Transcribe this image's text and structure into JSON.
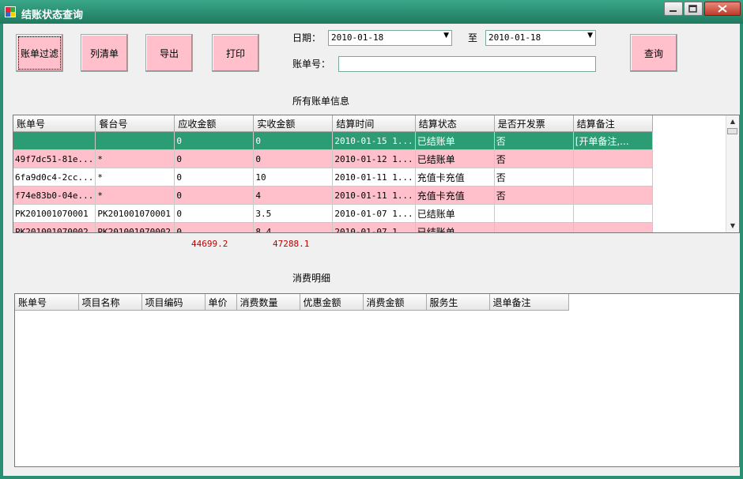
{
  "window": {
    "title": "结账状态查询"
  },
  "toolbar": {
    "filter_label": "账单过滤",
    "list_label": "列清单",
    "export_label": "导出",
    "print_label": "打印",
    "query_label": "查询"
  },
  "filters": {
    "date_label": "日期：",
    "to_label": "至",
    "date_from": "2010-01-18",
    "date_to": "2010-01-18",
    "bill_no_label": "账单号：",
    "bill_no_value": ""
  },
  "bills": {
    "section_title": "所有账单信息",
    "columns": [
      "账单号",
      "餐台号",
      "应收金额",
      "实收金额",
      "结算时间",
      "结算状态",
      "是否开发票",
      "结算备注"
    ],
    "rows": [
      [
        "",
        "",
        "0",
        "0",
        "2010-01-15 1...",
        "已结账单",
        "否",
        "[开单备注,..."
      ],
      [
        "49f7dc51-81e...",
        "*",
        "0",
        "0",
        "2010-01-12 1...",
        "已结账单",
        "否",
        ""
      ],
      [
        "6fa9d0c4-2cc...",
        "*",
        "0",
        "10",
        "2010-01-11 1...",
        "充值卡充值",
        "否",
        ""
      ],
      [
        "f74e83b0-04e...",
        "*",
        "0",
        "4",
        "2010-01-11 1...",
        "充值卡充值",
        "否",
        ""
      ],
      [
        "PK201001070001",
        "PK201001070001",
        "0",
        "3.5",
        "2010-01-07 1...",
        "已结账单",
        "",
        ""
      ],
      [
        "PK201001070002",
        "PK201001070002",
        "0",
        "8.4",
        "2010-01-07 1...",
        "已结账单",
        "",
        ""
      ]
    ],
    "total_receivable": "44699.2",
    "total_received": "47288.1"
  },
  "details": {
    "section_title": "消费明细",
    "columns": [
      "账单号",
      "项目名称",
      "项目编码",
      "单价",
      "消费数量",
      "优惠金额",
      "消费金额",
      "服务生",
      "退单备注"
    ]
  }
}
